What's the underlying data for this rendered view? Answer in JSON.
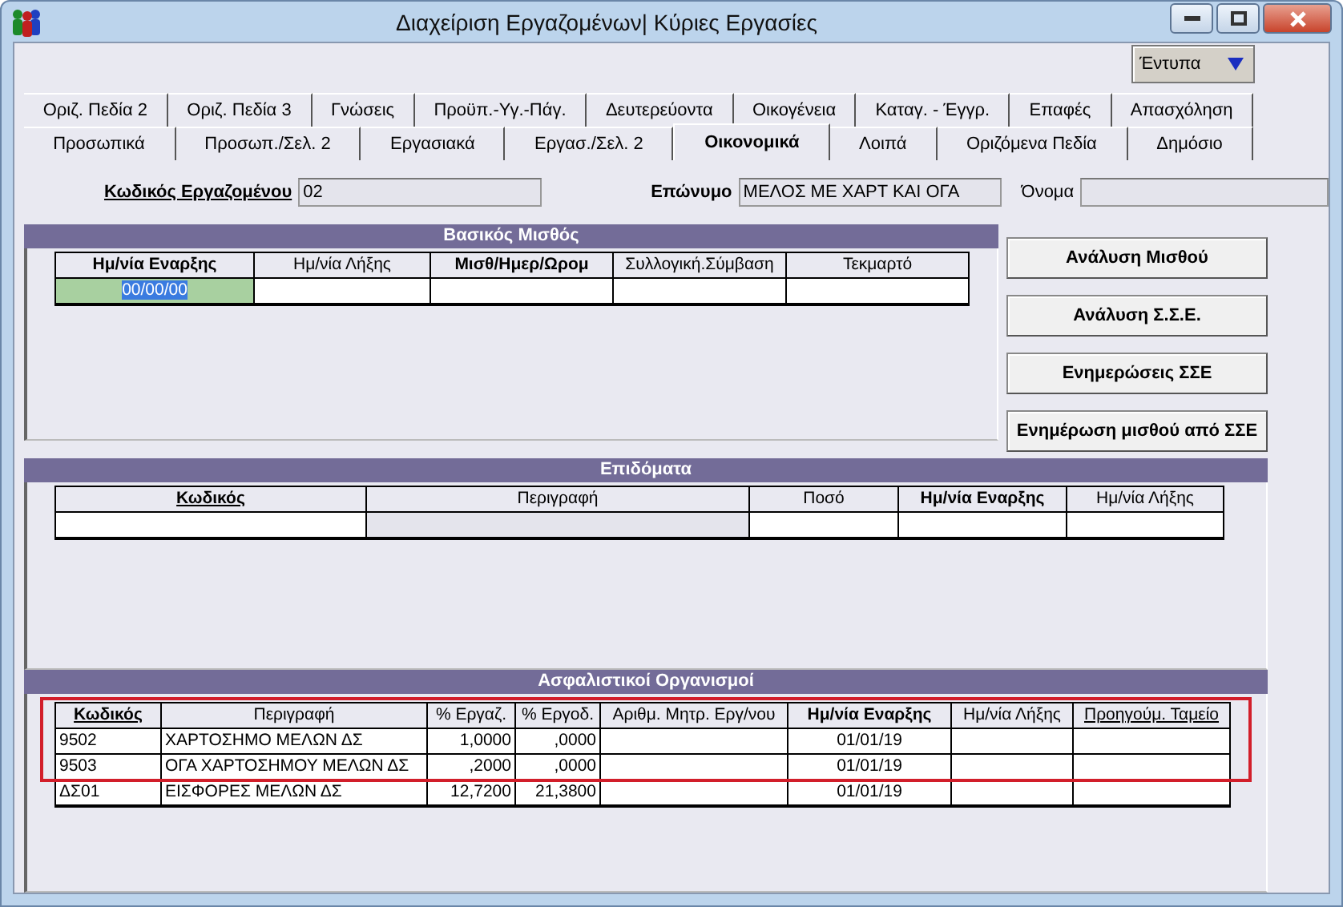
{
  "window": {
    "title": "Διαχείριση Εργαζομένων| Κύριες Εργασίες"
  },
  "print_menu": {
    "label": "Έντυπα"
  },
  "tab_rows": [
    [
      {
        "label": "Οριζ. Πεδία 2",
        "selected": false
      },
      {
        "label": "Οριζ. Πεδία 3",
        "selected": false
      },
      {
        "label": "Γνώσεις",
        "selected": false
      },
      {
        "label": "Προϋπ.-Υγ.-Πάγ.",
        "selected": false
      },
      {
        "label": "Δευτερεύοντα",
        "selected": false
      },
      {
        "label": "Οικογένεια",
        "selected": false
      },
      {
        "label": "Καταγ. - Έγγρ.",
        "selected": false
      },
      {
        "label": "Επαφές",
        "selected": false
      },
      {
        "label": "Απασχόληση",
        "selected": false
      }
    ],
    [
      {
        "label": "Προσωπικά",
        "selected": false
      },
      {
        "label": "Προσωπ./Σελ. 2",
        "selected": false
      },
      {
        "label": "Εργασιακά",
        "selected": false
      },
      {
        "label": "Εργασ./Σελ. 2",
        "selected": false
      },
      {
        "label": "Οικονομικά",
        "selected": true
      },
      {
        "label": "Λοιπά",
        "selected": false
      },
      {
        "label": "Οριζόμενα Πεδία",
        "selected": false
      },
      {
        "label": "Δημόσιο",
        "selected": false
      }
    ]
  ],
  "employee": {
    "code_label": "Κωδικός Εργαζομένου",
    "code": "02",
    "surname_label": "Επώνυμο",
    "surname": "ΜΕΛΟΣ ΜΕ ΧΑΡΤ ΚΑΙ ΟΓΑ",
    "name_label": "Όνομα"
  },
  "basic_salary": {
    "title": "Βασικός Μισθός",
    "columns": [
      {
        "label": "Ημ/νία Εναρξης",
        "bold": true,
        "underlined": false
      },
      {
        "label": "Ημ/νία Λήξης",
        "bold": false,
        "underlined": false
      },
      {
        "label": "Μισθ/Ημερ/Ωρομ",
        "bold": true,
        "underlined": false
      },
      {
        "label": "Συλλογική.Σύμβαση",
        "bold": false,
        "underlined": false
      },
      {
        "label": "Τεκμαρτό",
        "bold": false,
        "underlined": false
      }
    ],
    "rows": [
      {
        "cells": [
          {
            "text": "00/00/00",
            "focused": true
          }
        ]
      }
    ]
  },
  "buttons": [
    "Ανάλυση Μισθού",
    "Ανάλυση Σ.Σ.Ε.",
    "Ενημερώσεις ΣΣΕ",
    "Ενημέρωση μισθού από ΣΣΕ"
  ],
  "allowances": {
    "title": "Επιδόματα",
    "columns": [
      {
        "label": "Κωδικός",
        "bold": true,
        "underlined": true,
        "readonly": false
      },
      {
        "label": "Περιγραφή",
        "bold": false,
        "underlined": false,
        "readonly": true
      },
      {
        "label": "Ποσό",
        "bold": false,
        "underlined": false,
        "readonly": false
      },
      {
        "label": "Ημ/νία Εναρξης",
        "bold": true,
        "underlined": false,
        "readonly": false
      },
      {
        "label": "Ημ/νία Λήξης",
        "bold": false,
        "underlined": false,
        "readonly": false
      }
    ],
    "rows": [
      {
        "cells": []
      }
    ]
  },
  "insurance": {
    "title": "Ασφαλιστικοί Οργανισμοί",
    "columns": [
      {
        "label": "Κωδικός",
        "bold": true,
        "underlined": true
      },
      {
        "label": "Περιγραφή",
        "bold": false,
        "underlined": false
      },
      {
        "label": "% Εργαζ.",
        "bold": false,
        "underlined": false
      },
      {
        "label": "% Εργοδ.",
        "bold": false,
        "underlined": false
      },
      {
        "label": "Αριθμ. Μητρ. Εργ/νου",
        "bold": false,
        "underlined": false
      },
      {
        "label": "Ημ/νία Εναρξης",
        "bold": true,
        "underlined": false
      },
      {
        "label": "Ημ/νία Λήξης",
        "bold": false,
        "underlined": false
      },
      {
        "label": "Προηγούμ. Ταμείο",
        "bold": false,
        "underlined": true
      }
    ],
    "rows": [
      {
        "cells": [
          "9502",
          "ΧΑΡΤΟΣΗΜΟ ΜΕΛΩΝ ΔΣ",
          "1,0000",
          ",0000",
          null,
          "01/01/19"
        ],
        "highlighted": true
      },
      {
        "cells": [
          "9503",
          "ΟΓΑ ΧΑΡΤΟΣΗΜΟΥ ΜΕΛΩΝ ΔΣ",
          ",2000",
          ",0000",
          null,
          "01/01/19"
        ],
        "highlighted": true
      },
      {
        "cells": [
          "ΔΣ01",
          "ΕΙΣΦΟΡΕΣ ΜΕΛΩΝ ΔΣ",
          "12,7200",
          "21,3800",
          null,
          "01/01/19"
        ],
        "highlighted": false
      }
    ]
  }
}
